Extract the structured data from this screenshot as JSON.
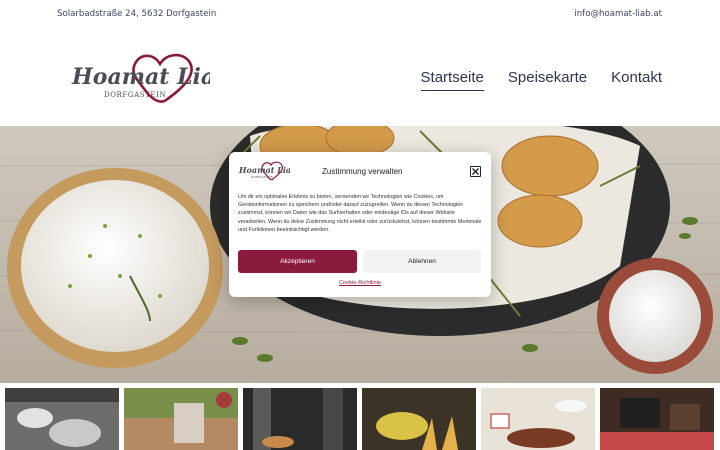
{
  "topbar": {
    "address": "Solarbadstraße 24, 5632 Dorfgastein",
    "email": "info@hoamat-liab.at"
  },
  "logo": {
    "name": "Hoamat Liab",
    "sub": "DORFGASTEIN"
  },
  "nav": {
    "items": [
      "Startseite",
      "Speisekarte",
      "Kontakt"
    ],
    "active": "Startseite"
  },
  "consent": {
    "title": "Zustimmung verwalten",
    "text": "Um dir ein optimales Erlebnis zu bieten, verwenden wir Technologien wie Cookies, um Geräteinformationen zu speichern und/oder darauf zuzugreifen. Wenn du diesen Technologien zustimmst, können wir Daten wie das Surfverhalten oder eindeutige IDs auf dieser Website verarbeiten. Wenn du deine Zustimmung nicht erteilst oder zurückziehst, können bestimmte Merkmale und Funktionen beeinträchtigt werden.",
    "accept_label": "Akzeptieren",
    "deny_label": "Ablehnen",
    "policy_label": "Cookie-Richtlinie"
  },
  "colors": {
    "brand": "#8a1b3c",
    "text": "#2c3550"
  },
  "icons": {
    "close": "close-icon"
  }
}
